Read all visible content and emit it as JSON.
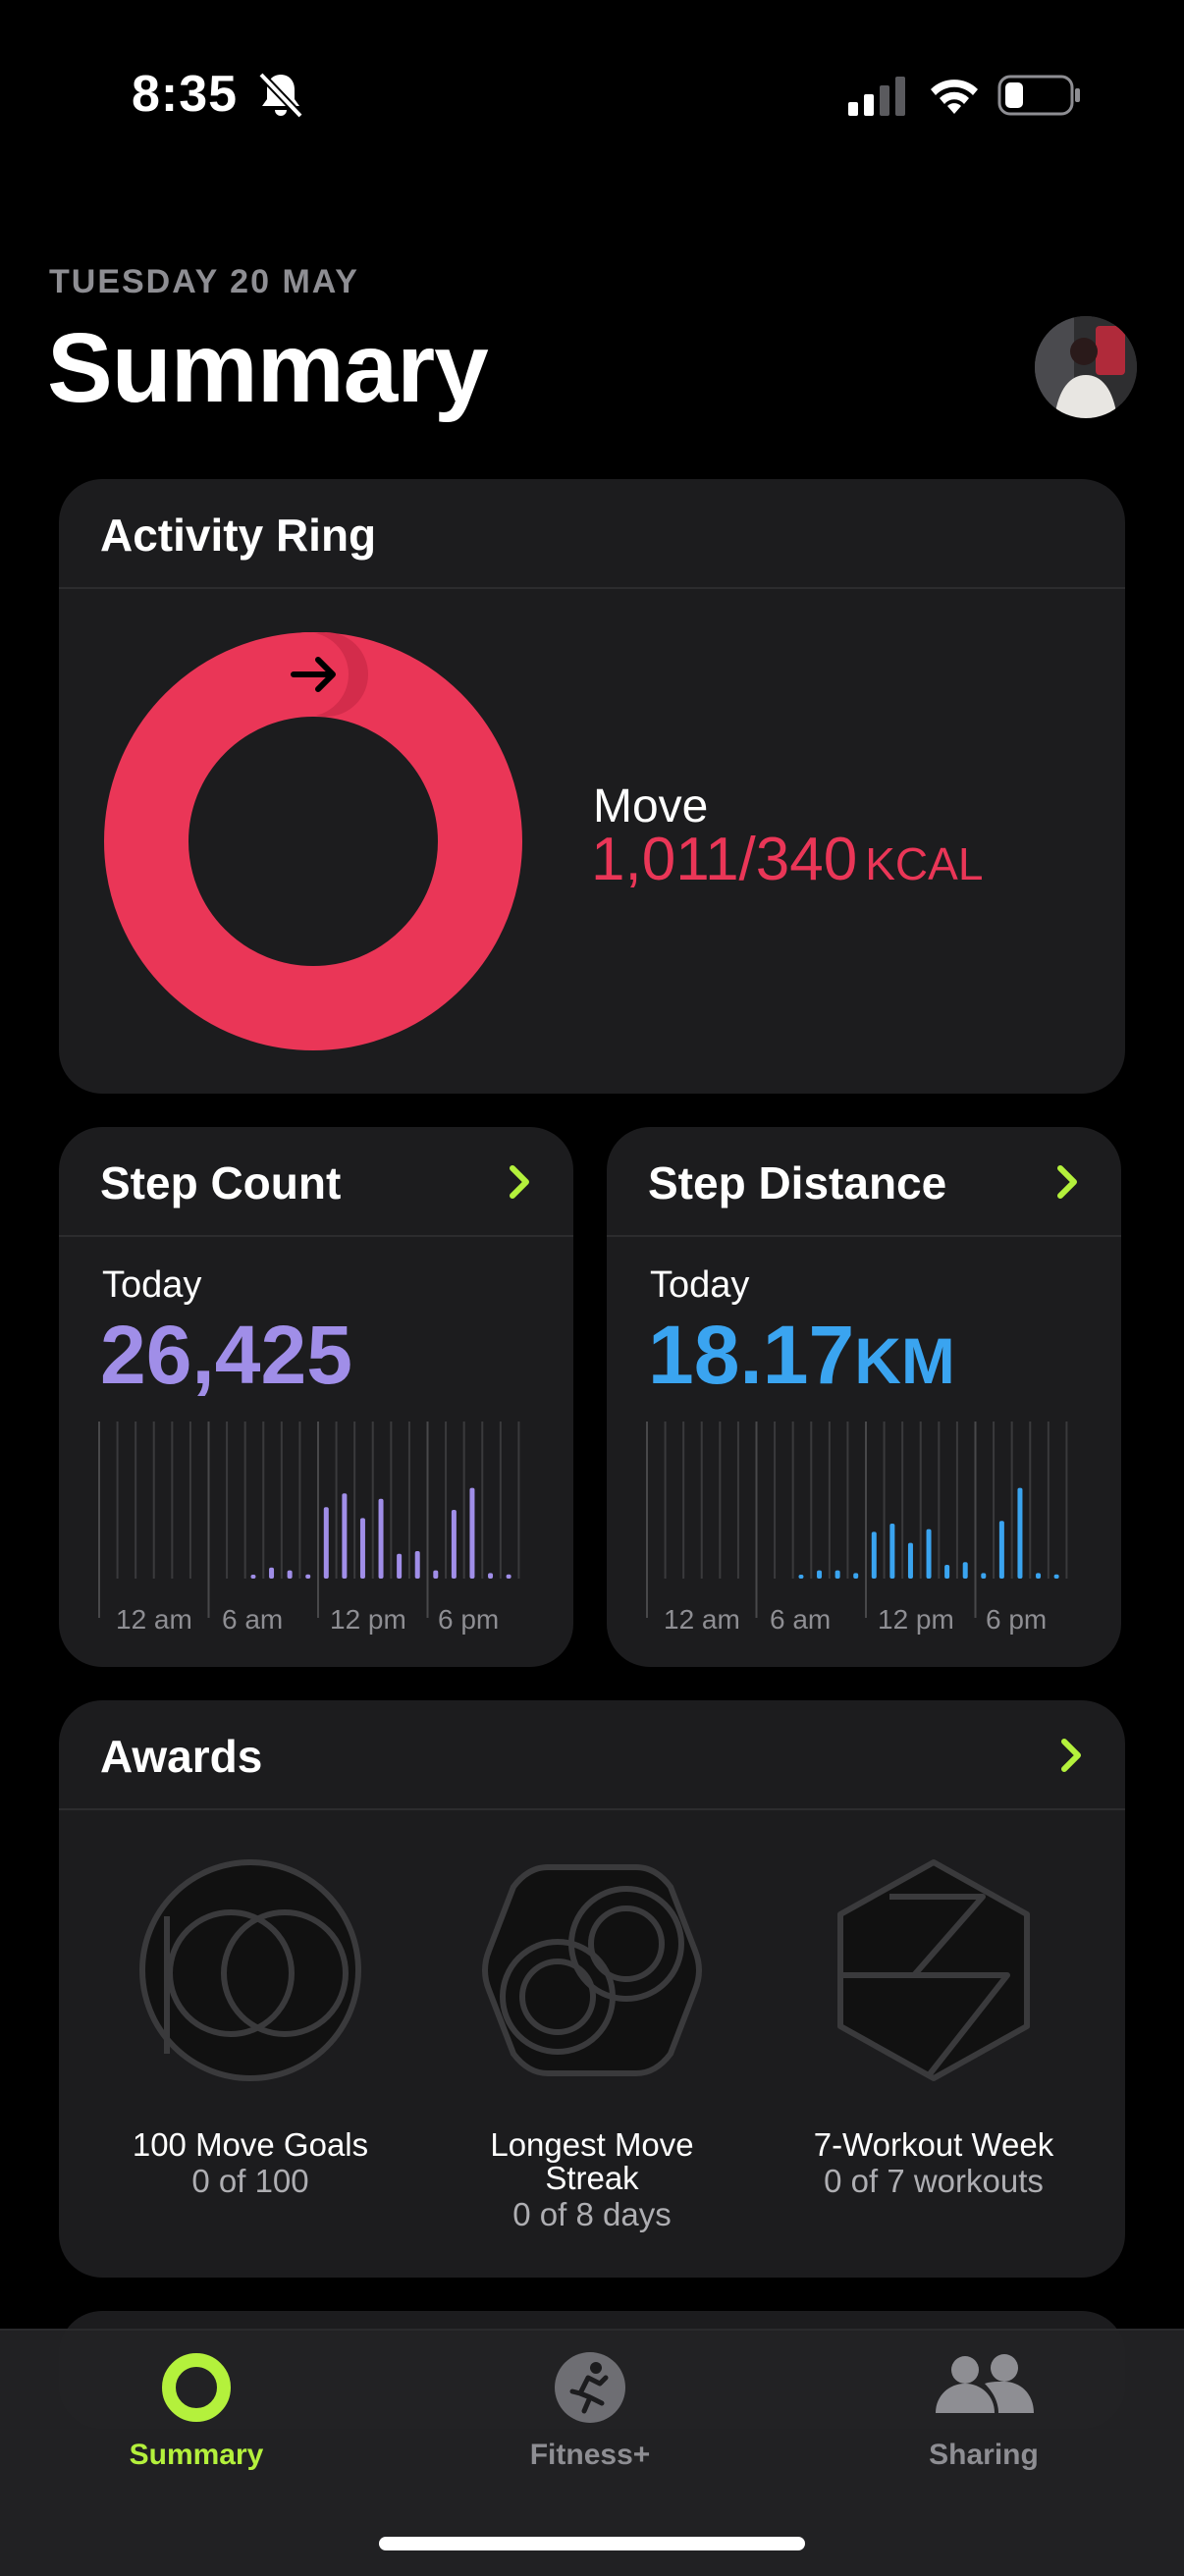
{
  "status_bar": {
    "time": "8:35",
    "bell_icon": "bell-slash-icon",
    "signal_icon": "cellular-signal-icon",
    "wifi_icon": "wifi-icon",
    "battery_icon": "battery-icon"
  },
  "header": {
    "date": "TUESDAY 20 MAY",
    "title": "Summary",
    "avatar_icon": "profile-avatar"
  },
  "activity_ring": {
    "title": "Activity Ring",
    "move_label": "Move",
    "move_value": "1,011/340",
    "move_unit": "KCAL",
    "ring_color": "#ea3657",
    "progress_fraction": 2.97
  },
  "step_count": {
    "title": "Step Count",
    "today_label": "Today",
    "value": "26,425",
    "color": "#a08ee8",
    "bars": [
      0,
      0,
      0,
      0,
      0,
      0,
      0,
      0,
      0.02,
      0.08,
      0.06,
      0.03,
      0.52,
      0.62,
      0.44,
      0.58,
      0.18,
      0.2,
      0.06,
      0.5,
      0.66,
      0.04,
      0.03,
      0
    ],
    "axis_labels": [
      "12 am",
      "6 am",
      "12 pm",
      "6 pm"
    ]
  },
  "step_distance": {
    "title": "Step Distance",
    "today_label": "Today",
    "value": "18.17",
    "unit": "KM",
    "color": "#3aa4f0",
    "bars": [
      0,
      0,
      0,
      0,
      0,
      0,
      0,
      0,
      0.02,
      0.06,
      0.06,
      0.04,
      0.34,
      0.4,
      0.26,
      0.36,
      0.1,
      0.12,
      0.04,
      0.42,
      0.66,
      0.04,
      0.03,
      0
    ],
    "axis_labels": [
      "12 am",
      "6 am",
      "12 pm",
      "6 pm"
    ]
  },
  "awards": {
    "title": "Awards",
    "items": [
      {
        "name": "100 Move Goals",
        "progress": "0 of 100",
        "icon": "hundred-move-goals-badge-icon"
      },
      {
        "name": "Longest Move Streak",
        "progress": "0 of 8 days",
        "icon": "move-streak-badge-icon"
      },
      {
        "name": "7-Workout Week",
        "progress": "0 of 7 workouts",
        "icon": "seven-workout-badge-icon"
      }
    ]
  },
  "tab_bar": {
    "items": [
      {
        "label": "Summary",
        "icon": "activity-ring-icon",
        "active": true
      },
      {
        "label": "Fitness+",
        "icon": "running-figure-icon",
        "active": false
      },
      {
        "label": "Sharing",
        "icon": "people-icon",
        "active": false
      }
    ],
    "active_color": "#b4f13c",
    "inactive_color": "#8e8e93"
  },
  "accent_chevron_color": "#b4f13c"
}
